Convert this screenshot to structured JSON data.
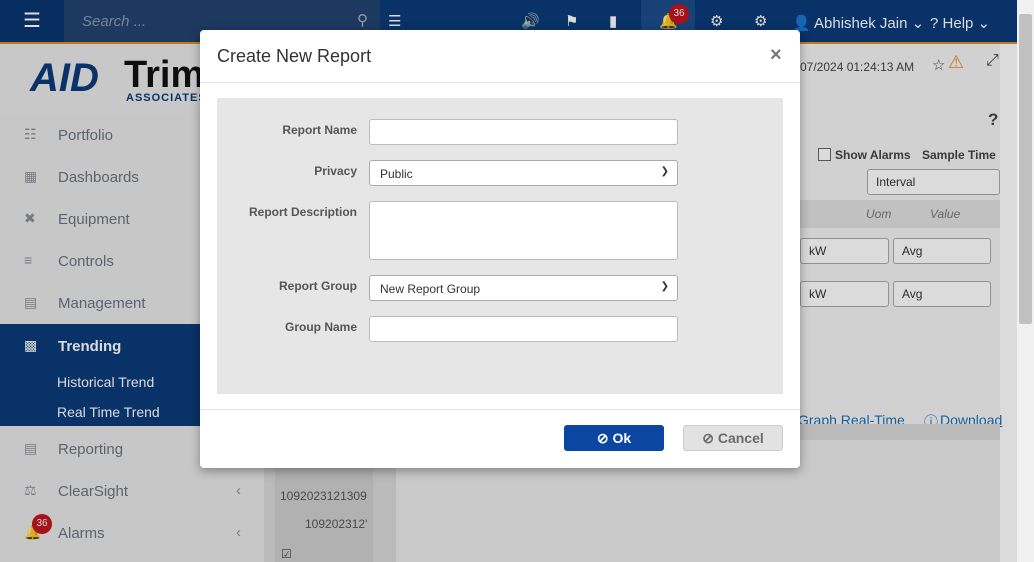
{
  "topbar": {
    "search_placeholder": "Search ...",
    "notification_count": "36",
    "user_name": "Abhishek Jain",
    "help_label": "Help"
  },
  "logo": {
    "mark": "AID",
    "word": "Trima",
    "sub": "ASSOCIATES,"
  },
  "sidebar": {
    "items": [
      {
        "label": "Portfolio",
        "icon": "sitemap-icon"
      },
      {
        "label": "Dashboards",
        "icon": "dashboard-icon"
      },
      {
        "label": "Equipment",
        "icon": "equipment-icon"
      },
      {
        "label": "Controls",
        "icon": "sliders-icon"
      },
      {
        "label": "Management",
        "icon": "inbox-icon"
      },
      {
        "label": "Trending",
        "icon": "bar-chart-icon"
      },
      {
        "label": "Reporting",
        "icon": "file-icon"
      },
      {
        "label": "ClearSight",
        "icon": "flask-icon"
      },
      {
        "label": "Alarms",
        "icon": "bell-icon"
      }
    ],
    "sub_items": [
      "Historical Trend",
      "Real Time Trend"
    ],
    "alarm_count": "36"
  },
  "background": {
    "timestamp": "07/2024 01:24:13 AM",
    "help_q": "?",
    "show_alarms": "Show Alarms",
    "sample_time": "Sample Time",
    "interval": "Interval",
    "uom": "Uom",
    "value": "Value",
    "kw1": "kW",
    "avg1": "Avg",
    "kw2": "kW",
    "avg2": "Avg",
    "graph_link": "Graph Real-Time",
    "download_link": "Download",
    "row_id1": "1092023121309",
    "row_id2": "109202312'"
  },
  "modal": {
    "title": "Create New Report",
    "close": "×",
    "fields": {
      "report_name_label": "Report Name",
      "report_name_value": "",
      "privacy_label": "Privacy",
      "privacy_value": "Public",
      "description_label": "Report Description",
      "report_group_label": "Report Group",
      "report_group_value": "New Report Group",
      "group_name_label": "Group Name",
      "group_name_value": ""
    },
    "ok_label": "Ok",
    "cancel_label": "Cancel"
  }
}
